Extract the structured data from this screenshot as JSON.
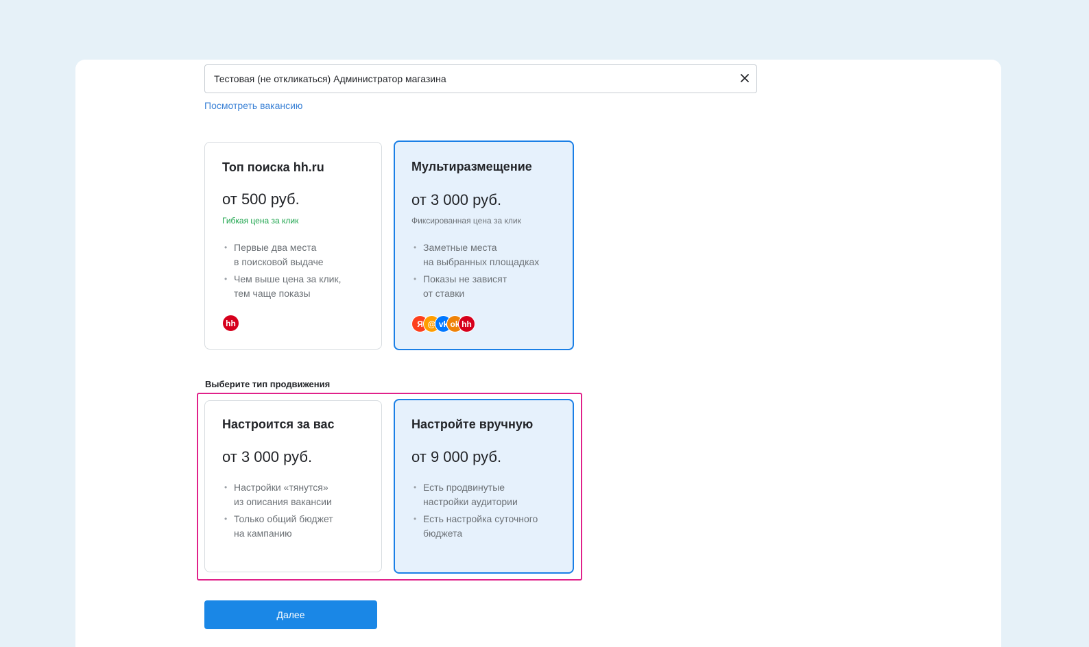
{
  "vacancy": {
    "value": "Тестовая (не откликаться) Администратор магазина",
    "clear_label": "×",
    "view_link": "Посмотреть вакансию"
  },
  "placement": {
    "cards": [
      {
        "title": "Топ поиска hh.ru",
        "price": "от 500 руб.",
        "note": "Гибкая цена за клик",
        "bullets": [
          "Первые два места\nв поисковой выдаче",
          "Чем выше цена за клик,\nтем чаще показы"
        ],
        "logos": [
          {
            "name": "hh-logo",
            "text": "hh",
            "color": "#d6001c"
          }
        ]
      },
      {
        "title": "Мультиразмещение",
        "price": "от 3 000 руб.",
        "note": "Фиксированная цена за клик",
        "bullets": [
          "Заметные места\nна выбранных площадках",
          "Показы не зависят\nот ставки"
        ],
        "logos": [
          {
            "name": "yandex-logo",
            "text": "Я",
            "color": "#fc3f1d"
          },
          {
            "name": "mail-logo",
            "text": "@",
            "color": "#ff9e00"
          },
          {
            "name": "vk-logo",
            "text": "vk",
            "color": "#0077ff"
          },
          {
            "name": "ok-logo",
            "text": "ok",
            "color": "#ee8208"
          },
          {
            "name": "hh-logo",
            "text": "hh",
            "color": "#d6001c"
          }
        ]
      }
    ]
  },
  "promotion": {
    "section_label": "Выберите тип продвижения",
    "cards": [
      {
        "title": "Настроится за вас",
        "price": "от 3 000 руб.",
        "bullets": [
          "Настройки «тянутся»\nиз описания вакансии",
          "Только общий бюджет\nна кампанию"
        ]
      },
      {
        "title": "Настройте вручную",
        "price": "от 9 000 руб.",
        "bullets": [
          "Есть продвинутые\nнастройки аудитории",
          "Есть настройка суточного\nбюджета"
        ]
      }
    ]
  },
  "next_button": "Далее",
  "colors": {
    "accent": "#1a87e6",
    "selected_border": "#1a7fe6",
    "selected_bg": "#e6f1fc",
    "highlight": "#e0218a",
    "flexible_note": "#1aa34a",
    "link": "#3b82d6"
  }
}
